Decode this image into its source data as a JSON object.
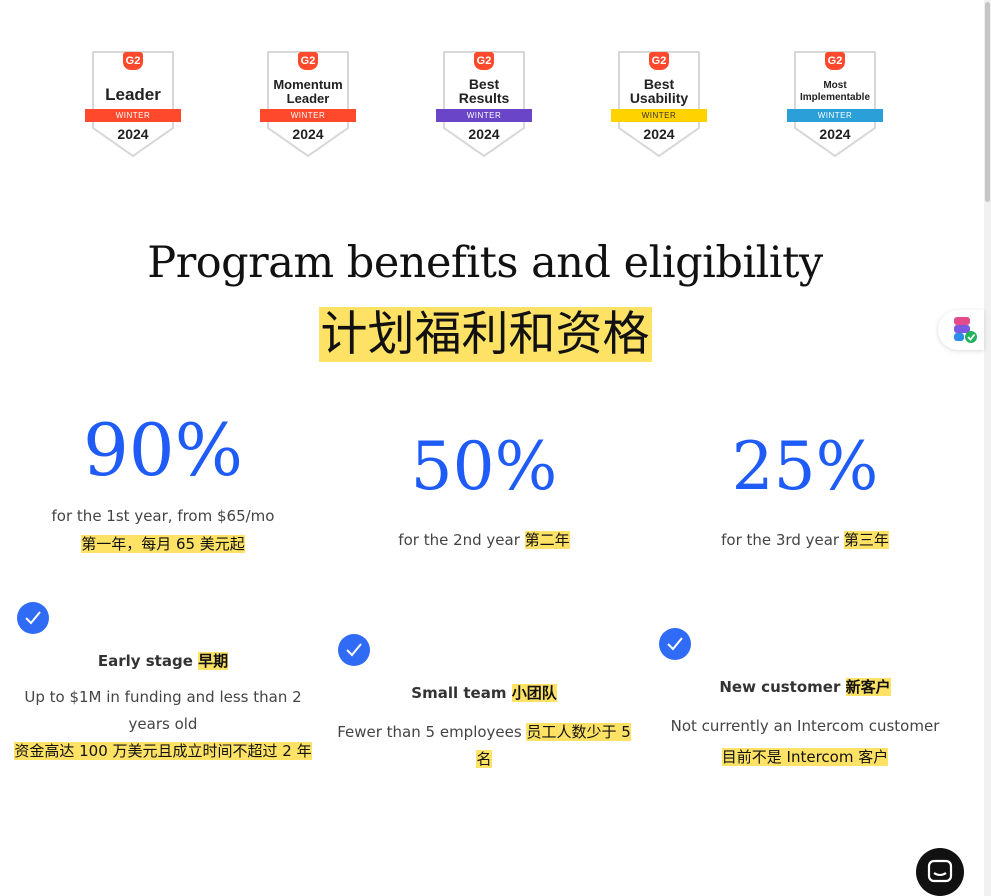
{
  "badges": [
    {
      "brand": "G2",
      "title": "Leader",
      "ribbon": "WINTER",
      "year": "2024",
      "color": "#ff492c"
    },
    {
      "brand": "G2",
      "title": "Momentum Leader",
      "ribbon": "WINTER",
      "year": "2024",
      "color": "#ff492c"
    },
    {
      "brand": "G2",
      "title": "Best Results",
      "ribbon": "WINTER",
      "year": "2024",
      "color": "#6a45c7"
    },
    {
      "brand": "G2",
      "title": "Best Usability",
      "ribbon": "WINTER",
      "year": "2024",
      "color": "#ffd200"
    },
    {
      "brand": "G2",
      "title": "Most Implementable",
      "ribbon": "WINTER",
      "year": "2024",
      "color": "#2a9fd8"
    }
  ],
  "heading": {
    "title": "Program benefits and eligibility",
    "title_cn": "计划福利和资格"
  },
  "stats": [
    {
      "percent": "90%",
      "desc": "for the 1st year, from $65/mo",
      "cn": "第一年，每月 65 美元起"
    },
    {
      "percent": "50%",
      "desc": "for the 2nd year",
      "cn": "第二年"
    },
    {
      "percent": "25%",
      "desc": "for the 3rd year",
      "cn": "第三年"
    }
  ],
  "criteria": [
    {
      "title": "Early stage",
      "title_cn": "早期",
      "body": "Up to $1M in funding and less than 2 years old",
      "body_cn": "资金高达 100 万美元且成立时间不超过 2 年"
    },
    {
      "title": "Small team",
      "title_cn": "小团队",
      "body": "Fewer than 5 employees",
      "body_cn": "员工人数少于 5 名"
    },
    {
      "title": "New customer",
      "title_cn": "新客户",
      "body": "Not currently an Intercom customer",
      "body_cn": "目前不是 Intercom 客户"
    }
  ],
  "colors": {
    "accent": "#1f5cf7",
    "highlight": "#fde266",
    "check": "#2f6bf5"
  },
  "icons": {
    "check": "check-circle-icon",
    "chat": "chat-bubble-icon",
    "extension": "extension-icon"
  }
}
